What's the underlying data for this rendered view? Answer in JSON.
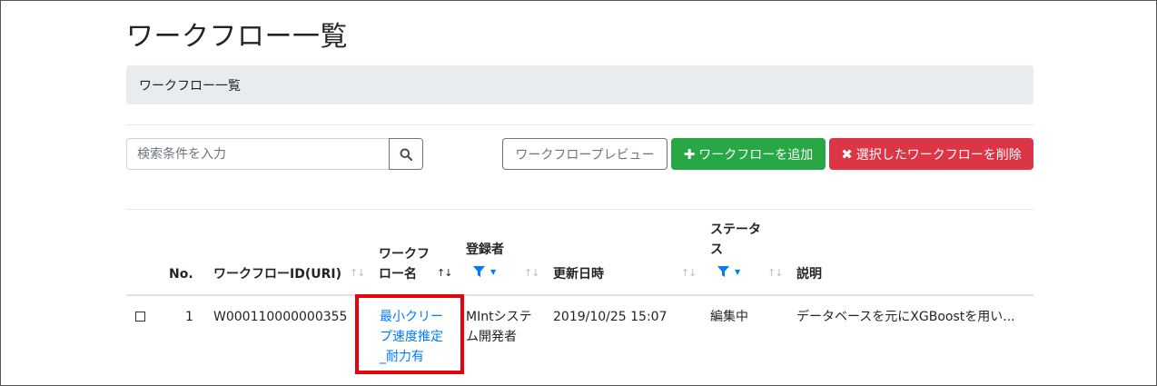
{
  "page": {
    "title": "ワークフロー一覧"
  },
  "breadcrumb": {
    "current": "ワークフロー一覧"
  },
  "search": {
    "placeholder": "検索条件を入力",
    "icon": "search-icon"
  },
  "toolbar": {
    "preview_label": "ワークフロープレビュー",
    "add_label": "ワークフローを追加",
    "add_icon": "plus-icon",
    "delete_label": "選択したワークフローを削除",
    "delete_icon": "times-icon"
  },
  "colors": {
    "primary": "#007bff",
    "success": "#28a745",
    "danger": "#dc3545",
    "secondary": "#6c757d",
    "highlight": "#e8000b"
  },
  "table": {
    "columns": {
      "no": "No.",
      "id": "ワークフローID(URI)",
      "name_line1": "ワークフ",
      "name_line2": "ロー名",
      "registrant": "登録者",
      "updated": "更新日時",
      "status_line1": "ステータ",
      "status_line2": "ス",
      "description": "説明"
    },
    "sort_glyph": "↑↓",
    "sort_active_glyph": "↑↓",
    "rows": [
      {
        "no": "1",
        "id": "W000110000000355",
        "name_line1": "最小クリー",
        "name_line2": "プ速度推定",
        "name_line3": "_耐力有",
        "registrant_line1": "MIntシステ",
        "registrant_line2": "ム開発者",
        "updated": "2019/10/25 15:07",
        "status": "編集中",
        "description": "データベースを元にXGBoostを用い..."
      }
    ]
  }
}
